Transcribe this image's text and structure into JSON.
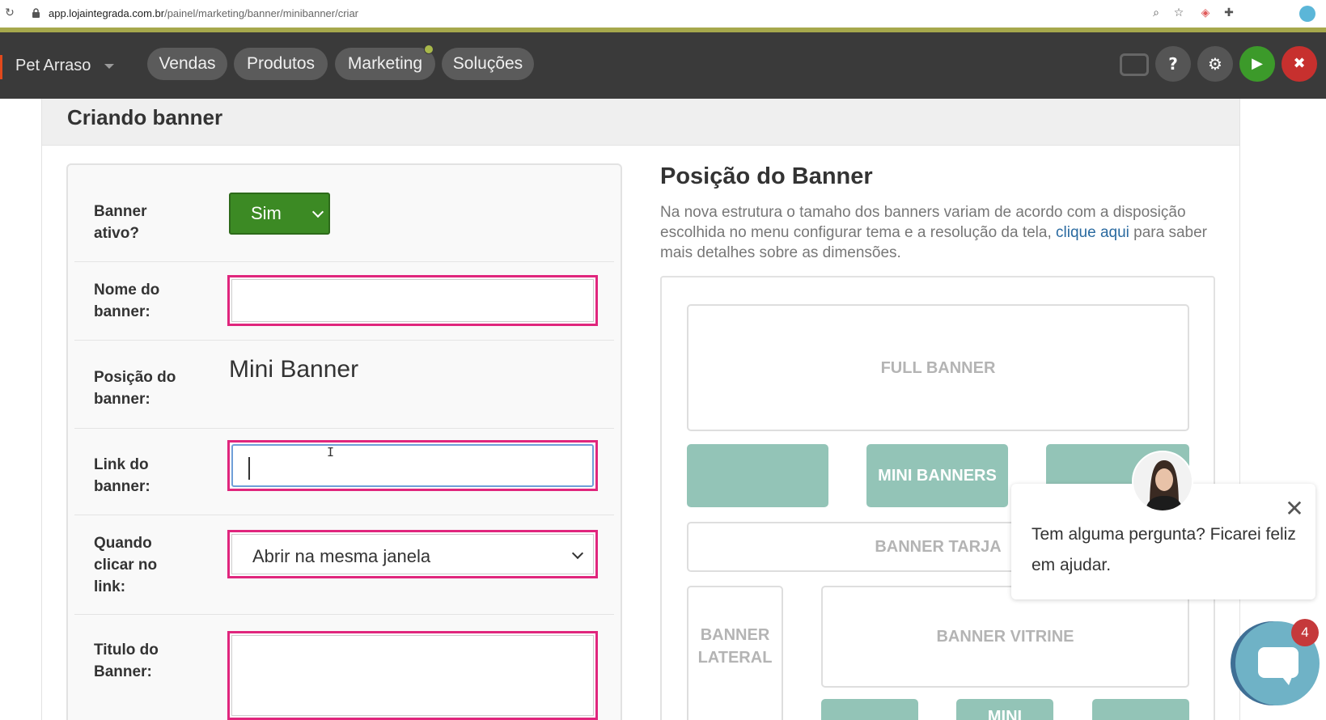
{
  "browser": {
    "url_host": "app.lojaintegrada.com.br",
    "url_path": "/painel/marketing/banner/minibanner/criar"
  },
  "header": {
    "store_name": "Pet Arraso",
    "nav": [
      "Vendas",
      "Produtos",
      "Marketing",
      "Soluções"
    ],
    "help_glyph": "?",
    "settings_glyph": "⚙",
    "play_glyph": "▶",
    "close_glyph": "✖"
  },
  "page": {
    "title": "Criando banner"
  },
  "form": {
    "active_label": "Banner ativo?",
    "active_value": "Sim",
    "name_label": "Nome do banner:",
    "name_value": "",
    "position_label": "Posição do banner:",
    "position_value": "Mini Banner",
    "link_label": "Link do banner:",
    "link_value": "",
    "target_label": "Quando clicar no link:",
    "target_value": "Abrir na mesma janela",
    "title_label": "Titulo do Banner:",
    "title_value": ""
  },
  "position_panel": {
    "title": "Posição do Banner",
    "desc_before": "Na nova estrutura o tamaho dos banners variam de acordo com a disposição escolhida no menu configurar tema e a resolução da tela, ",
    "desc_link": "clique aqui",
    "desc_after": " para saber mais detalhes sobre as dimensões.",
    "full_banner": "FULL BANNER",
    "mini_banners": "MINI BANNERS",
    "banner_tarja": "BANNER TARJA",
    "banner_lateral": "BANNER LATERAL",
    "banner_vitrine": "BANNER VITRINE",
    "mini_cut": "MINI"
  },
  "chat": {
    "message": "Tem alguma pergunta? Ficarei feliz em ajudar.",
    "close_glyph": "✕",
    "badge": "4"
  },
  "colors": {
    "header_bg": "#3a3a3a",
    "accent_green": "#3c8a24",
    "highlight_pink": "#e0267d",
    "mini_teal": "#93c4b7",
    "link_blue": "#2a6aa0",
    "chat_blue": "#6fb2c6",
    "badge_red": "#c5393b"
  }
}
